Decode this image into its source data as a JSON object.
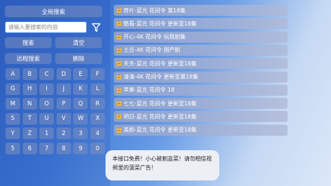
{
  "left_panel": {
    "global_search_label": "全局搜索",
    "search_placeholder": "请输入要搜索的内容",
    "search_label": "搜索",
    "clear_label": "清空",
    "remote_search_label": "远程搜索",
    "delete_label": "删除",
    "filter_icon": "filter-icon"
  },
  "keyboard": {
    "rows": [
      [
        "A",
        "B",
        "C",
        "D",
        "E",
        "F"
      ],
      [
        "G",
        "H",
        "I",
        "J",
        "K",
        "L"
      ],
      [
        "M",
        "N",
        "O",
        "P",
        "Q",
        "R"
      ],
      [
        "S",
        "T",
        "U",
        "V",
        "W",
        "X"
      ],
      [
        "Y",
        "Z",
        "1",
        "2",
        "3",
        "4"
      ],
      [
        "5",
        "6",
        "7",
        "8",
        "9",
        "0"
      ]
    ]
  },
  "results": [
    {
      "text": "荐片-蓝光 花间令 第18集",
      "icon": "cat-icon"
    },
    {
      "text": "酷看-蓝光 花间令 更新至18集",
      "icon": "cat-icon"
    },
    {
      "text": "开心-4K 花间令 玩我剧集",
      "icon": "cat-icon"
    },
    {
      "text": "土豆-4K 花间令 国产剧",
      "icon": "cat-icon"
    },
    {
      "text": "天天-蓝光 花间令 更新至18集",
      "icon": "cat-icon"
    },
    {
      "text": "清清-4K 花间令 更新至第18集",
      "icon": "cat-icon"
    },
    {
      "text": "苹果-蓝光 花间令 18",
      "icon": "cat-icon"
    },
    {
      "text": "七七-蓝光 花间令 更新至18集",
      "icon": "cat-icon"
    },
    {
      "text": "明日-蓝光 花间令 更新至18集",
      "icon": "cat-icon"
    },
    {
      "text": "美剧-蓝光 花间令 更新至18集",
      "icon": "cat-icon"
    }
  ],
  "notice": {
    "line1": "本接口免费！小心被割韭菜！请勿相信视",
    "line2": "频里的菠菜广告！"
  },
  "colors": {
    "accent": "#4a8be8",
    "icon_cat": "#f2b93b"
  }
}
